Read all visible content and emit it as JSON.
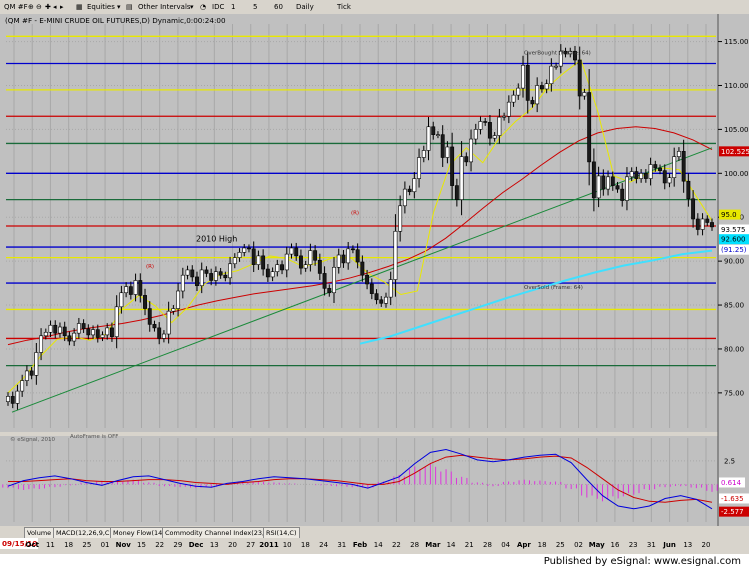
{
  "toolbar": {
    "symbol": "QM #F",
    "equities_label": "Equities",
    "other_intervals_label": "Other Intervals",
    "interval_buttons": [
      "IDC",
      "1",
      "5",
      "60",
      "Daily",
      "Tick"
    ]
  },
  "chart_header": "(QM #F - E-MINI CRUDE OIL FUTURES,D) Dynamic,0:00:24:00",
  "footer_text": "Published by eSignal: www.esignal.com",
  "indicator_tabs": [
    "Volume",
    "MACD(12,26,9,C)",
    "Money Flow(14)",
    "Commodity Channel Index(23,C)",
    "RSI(14,C)"
  ],
  "chart_data": [
    {
      "type": "candlestick",
      "title": "(QM #F - E-MINI CRUDE OIL FUTURES,D) Dynamic,0:00:24:00",
      "y_ticks": [
        "115.00",
        "110.00",
        "105.00",
        "100.00",
        "95.00",
        "90.00",
        "85.00",
        "80.00",
        "75.00"
      ],
      "ylim": [
        71,
        117
      ],
      "x_tick_labels": [
        "27",
        "Oct",
        "11",
        "18",
        "25",
        "01",
        "Nov",
        "15",
        "22",
        "29",
        "Dec",
        "13",
        "20",
        "27",
        "2011",
        "10",
        "18",
        "24",
        "31",
        "Feb",
        "14",
        "22",
        "28",
        "Mar",
        "14",
        "21",
        "28",
        "04",
        "Apr",
        "18",
        "25",
        "02",
        "May",
        "16",
        "23",
        "31",
        "Jun",
        "13",
        "20"
      ],
      "x_start_date": "09/15/10",
      "horizontal_levels": [
        {
          "value": 115.6,
          "color": "#e8e800"
        },
        {
          "value": 112.5,
          "color": "#0000cc"
        },
        {
          "value": 109.5,
          "color": "#e8e800"
        },
        {
          "value": 106.5,
          "color": "#cc0000"
        },
        {
          "value": 103.4,
          "color": "#1a6b3a"
        },
        {
          "value": 100.0,
          "color": "#0000cc"
        },
        {
          "value": 97.0,
          "color": "#1a6b3a"
        },
        {
          "value": 94.0,
          "color": "#cc0000"
        },
        {
          "value": 91.6,
          "color": "#0000cc"
        },
        {
          "value": 90.4,
          "color": "#e8e800"
        },
        {
          "value": 87.5,
          "color": "#0000cc"
        },
        {
          "value": 84.5,
          "color": "#e8e800"
        },
        {
          "value": 81.2,
          "color": "#cc0000"
        },
        {
          "value": 78.1,
          "color": "#1a6b3a"
        }
      ],
      "closes": [
        74.6,
        73.8,
        75.2,
        76.4,
        77.5,
        77.0,
        79.6,
        81.5,
        81.9,
        82.7,
        81.8,
        82.5,
        81.5,
        80.9,
        81.8,
        82.9,
        82.3,
        81.6,
        82.2,
        81.3,
        81.6,
        82.4,
        81.4,
        84.8,
        86.4,
        87.1,
        86.2,
        87.8,
        86.1,
        84.6,
        82.8,
        82.4,
        81.2,
        81.7,
        84.3,
        84.6,
        86.6,
        88.4,
        89.0,
        88.2,
        87.2,
        89.0,
        88.6,
        87.8,
        88.8,
        88.4,
        88.1,
        89.7,
        90.4,
        91.0,
        91.5,
        91.4,
        89.6,
        90.6,
        89.1,
        88.2,
        88.8,
        89.6,
        89.0,
        90.8,
        91.5,
        90.6,
        89.2,
        89.6,
        91.2,
        90.1,
        88.6,
        86.9,
        86.4,
        89.3,
        90.7,
        89.8,
        91.4,
        91.3,
        89.9,
        88.4,
        87.4,
        86.3,
        85.6,
        85.2,
        85.9,
        87.9,
        93.4,
        96.3,
        98.2,
        97.9,
        99.4,
        101.8,
        102.6,
        105.3,
        104.4,
        104.4,
        101.8,
        103.0,
        98.6,
        97.0,
        101.9,
        101.3,
        103.9,
        105.0,
        105.9,
        105.8,
        104.0,
        104.3,
        106.4,
        106.5,
        108.1,
        108.9,
        109.7,
        112.3,
        108.3,
        107.9,
        110.0,
        109.6,
        110.2,
        112.2,
        112.2,
        113.9,
        113.6,
        113.9,
        112.9,
        108.8,
        109.2,
        101.3,
        97.2,
        99.7,
        98.2,
        99.6,
        98.6,
        98.2,
        96.9,
        99.6,
        100.2,
        99.4,
        100.0,
        99.4,
        101.0,
        100.6,
        100.3,
        98.9,
        99.5,
        101.9,
        102.5,
        99.1,
        97.1,
        94.8,
        93.6,
        94.8,
        94.4,
        93.9
      ],
      "series_sma_slow": [
        80.5,
        81.0,
        81.4,
        81.9,
        82.3,
        82.6,
        82.9,
        83.3,
        83.8,
        84.4,
        85.0,
        85.5,
        85.9,
        86.3,
        86.6,
        86.9,
        87.2,
        87.6,
        88.1,
        88.7,
        89.4,
        90.2,
        91.2,
        92.6,
        94.3,
        96.1,
        97.8,
        99.3,
        100.9,
        102.4,
        103.7,
        104.6,
        105.1,
        105.3,
        105.1,
        104.6,
        103.8,
        102.7
      ],
      "series_sma_fast": [
        75.0,
        76.8,
        79.2,
        81.1,
        81.4,
        81.0,
        81.7,
        84.6,
        86.1,
        84.9,
        83.0,
        84.8,
        87.4,
        88.5,
        88.9,
        89.7,
        90.6,
        90.3,
        89.4,
        89.8,
        90.5,
        90.3,
        88.6,
        87.6,
        86.2,
        86.6,
        95.6,
        101.0,
        102.9,
        101.2,
        104.0,
        105.9,
        107.4,
        109.9,
        111.5,
        112.9,
        107.2,
        99.7,
        99.0,
        99.9,
        100.6,
        100.4,
        97.5,
        94.6
      ],
      "series_trend_green": [
        72.8,
        102.9
      ],
      "series_cyan": [
        80.6,
        81.4,
        82.5,
        83.6,
        84.7,
        85.8,
        86.8,
        87.8,
        88.7,
        89.5,
        90.1,
        90.8,
        91.2
      ],
      "annotations": [
        {
          "text": "2010 High",
          "value": 92.0
        },
        {
          "text": "OverBought (Frame: 64)",
          "value": 113.3
        },
        {
          "text": "OverSold (Frame: 64)",
          "value": 86.6
        },
        {
          "text": "(R)",
          "value": 89.0
        },
        {
          "text": "(R)",
          "value": 95.1
        },
        {
          "text": "AutoFrame is OFF",
          "value": 0
        },
        {
          "text": "© eSignal, 2010",
          "value": 0
        }
      ],
      "price_labels": [
        {
          "text": "102.525",
          "value": 102.5,
          "bg": "#cc0000",
          "fg": "#ffffff"
        },
        {
          "text": "95.0",
          "value": 95.3,
          "bg": "#e8e800",
          "fg": "#000000"
        },
        {
          "text": "93.575",
          "value": 93.6,
          "bg": "#ffffff",
          "fg": "#000000"
        },
        {
          "text": "92.600",
          "value": 92.5,
          "bg": "#00e0ff",
          "fg": "#000000"
        },
        {
          "text": "(91.25)",
          "value": 91.3,
          "bg": "#ffffff",
          "fg": "#0000cc"
        }
      ]
    },
    {
      "type": "line",
      "title": "MACD(12,26,9,C)",
      "y_ticks": [
        "2.5",
        "0"
      ],
      "ylim": [
        -4,
        4.5
      ],
      "macd_line": [
        -0.2,
        0.4,
        0.7,
        0.9,
        0.6,
        0.2,
        -0.1,
        0.4,
        0.8,
        0.9,
        0.5,
        0.1,
        -0.2,
        -0.3,
        0.1,
        0.3,
        0.6,
        0.8,
        0.7,
        0.6,
        0.4,
        0.2,
        0.0,
        -0.4,
        0.2,
        0.8,
        2.2,
        3.4,
        3.7,
        3.2,
        2.6,
        2.4,
        2.6,
        2.9,
        3.1,
        3.2,
        2.3,
        0.5,
        -1.2,
        -2.3,
        -2.6,
        -2.3,
        -1.5,
        -1.2,
        -1.6,
        -2.6
      ],
      "signal_line": [
        0.3,
        0.3,
        0.4,
        0.5,
        0.6,
        0.4,
        0.3,
        0.3,
        0.4,
        0.5,
        0.5,
        0.4,
        0.2,
        0.1,
        0.0,
        0.2,
        0.3,
        0.5,
        0.6,
        0.6,
        0.5,
        0.4,
        0.2,
        0.0,
        0.0,
        0.3,
        1.2,
        2.2,
        2.9,
        3.1,
        2.9,
        2.7,
        2.6,
        2.7,
        2.9,
        3.0,
        2.8,
        1.8,
        0.6,
        -0.6,
        -1.4,
        -1.8,
        -1.9,
        -1.7,
        -1.6,
        -1.9
      ],
      "histogram": [
        -0.4,
        -0.6,
        -0.5,
        -0.3,
        -0.1,
        0.2,
        0.4,
        0.3,
        0.5,
        0.2,
        -0.2,
        -0.3,
        -0.4,
        -0.3,
        0.1,
        0.2,
        0.3,
        0.2,
        0.1,
        0.0,
        -0.1,
        -0.2,
        -0.3,
        -0.4,
        0.3,
        1.0,
        1.9,
        2.2,
        1.6,
        0.8,
        0.2,
        -0.2,
        0.3,
        0.5,
        0.4,
        0.3,
        -0.5,
        -1.4,
        -1.8,
        -1.5,
        -1.1,
        -0.6,
        -0.3,
        -0.2,
        -0.4,
        -0.8
      ],
      "value_labels": [
        {
          "text": "0.614",
          "value": 0.2,
          "bg": "#ffffff",
          "fg": "#cc00cc"
        },
        {
          "text": "-1.635",
          "value": -1.5,
          "bg": "#ffffff",
          "fg": "#cc0000"
        },
        {
          "text": "-2.577",
          "value": -2.9,
          "bg": "#cc0000",
          "fg": "#ffffff"
        }
      ]
    }
  ]
}
